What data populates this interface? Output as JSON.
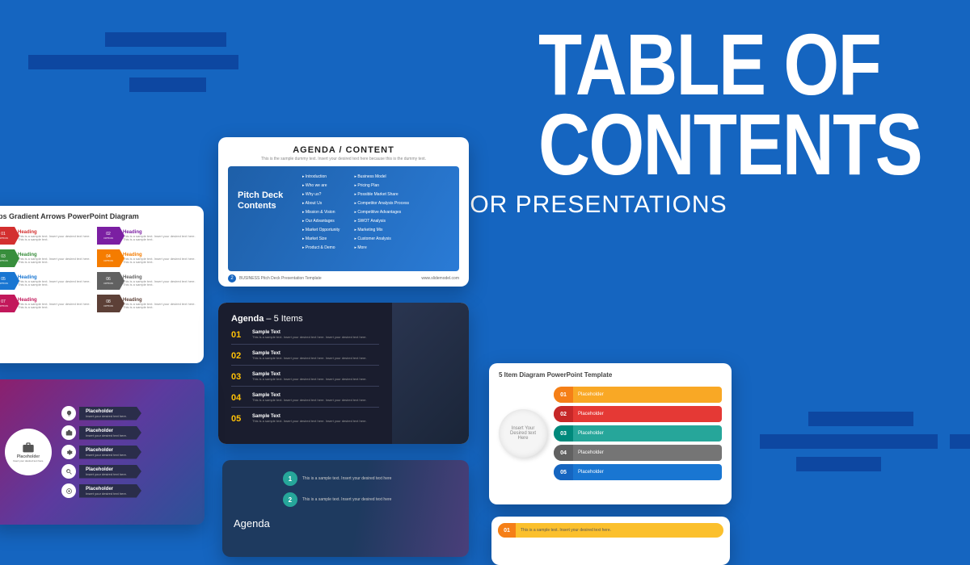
{
  "hero": {
    "line1": "TABLE OF",
    "line2": "CONTENTS",
    "sub": "FOR PRESENTATIONS"
  },
  "card1": {
    "title": "AGENDA / CONTENT",
    "subtitle": "This is the sample dummy text. Insert your desired text here because this is the dummy text.",
    "pd_title": "Pitch Deck Contents",
    "col1": [
      "Introduction",
      "Who we are",
      "Why us?",
      "About Us",
      "Mission & Vision",
      "Our Advantages",
      "Market Opportunity",
      "Market Size",
      "Product & Demo"
    ],
    "col2": [
      "Business Model",
      "Pricing Plan",
      "Possible Market Share",
      "Competitor Analysis Process",
      "Competitive Advantages",
      "SWOT Analysis",
      "Marketing Mix",
      "Customer Analysis",
      "More"
    ],
    "footer_num": "2",
    "footer_text": "BUSINESS Pitch Deck  Presentation Template",
    "footer_url": "www.slidemodel.com"
  },
  "card2": {
    "title": "teps Gradient Arrows PowerPoint Diagram",
    "heading": "Heading",
    "body": "This is a sample text. Insert your desired text here. This is a sample text.",
    "opts": [
      "01",
      "02",
      "03",
      "04",
      "05",
      "06",
      "07",
      "08"
    ],
    "opt_label": "OPTION"
  },
  "card3": {
    "title_bold": "Agenda",
    "title_rest": " – 5 Items",
    "nums": [
      "01",
      "02",
      "03",
      "04",
      "05"
    ],
    "h": "Sample Text",
    "p": "This is a sample text. Insert your desired text here. Insert your desired text here."
  },
  "card4": {
    "center": "Placeholder",
    "center_sub": "Insert your desired text here.",
    "item": "Placeholder",
    "item_sub": "Insert your desired text here."
  },
  "card5": {
    "title": "Agenda",
    "nums": [
      "1",
      "2"
    ],
    "text": "This is a sample text. Insert your desired text here"
  },
  "card6": {
    "title": "5 Item Diagram PowerPoint Template",
    "oval": "Insert Your Desired text Here",
    "nums": [
      "01",
      "02",
      "03",
      "04",
      "05"
    ],
    "label": "Placeholder"
  },
  "card7": {
    "num": "01",
    "text": "This is a sample text. Insert your desired text here."
  }
}
